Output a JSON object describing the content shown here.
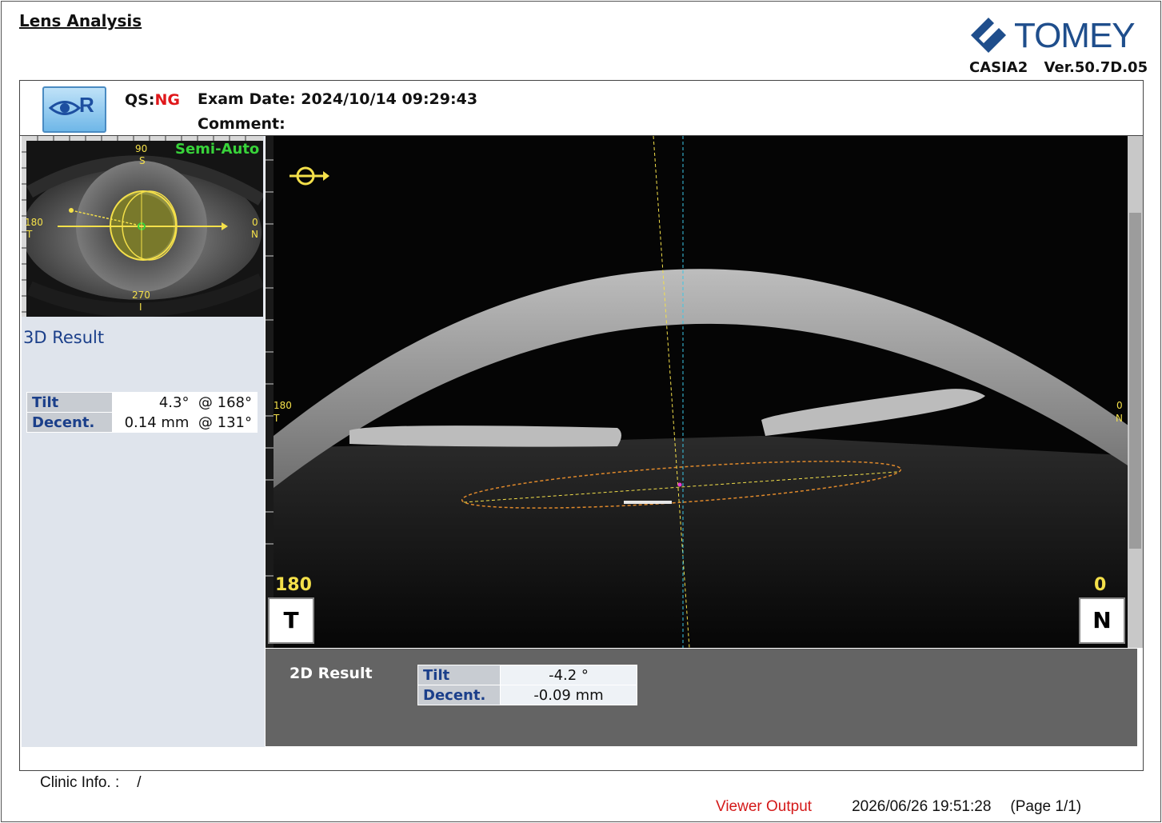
{
  "page": {
    "title": "Lens Analysis",
    "brand": "TOMEY",
    "device": "CASIA2",
    "version": "Ver.50.7D.05"
  },
  "header": {
    "eye": "R",
    "qs_label": "QS:",
    "qs_value": "NG",
    "exam_date_label": "Exam Date:",
    "exam_date": "2024/10/14 09:29:43",
    "comment_label": "Comment:"
  },
  "fundus": {
    "mode": "Semi-Auto",
    "top_deg": "90",
    "top_dir": "S",
    "left_deg": "180",
    "left_dir": "T",
    "right_deg": "0",
    "right_dir": "N",
    "bottom_deg": "270",
    "bottom_dir": "I"
  },
  "result3d": {
    "title": "3D Result",
    "rows": [
      {
        "label": "Tilt",
        "value": "4.3°",
        "angle": "@ 168°"
      },
      {
        "label": "Decent.",
        "value": "0.14 mm",
        "angle": "@ 131°"
      }
    ]
  },
  "oct": {
    "left_angle": "180",
    "left_dir": "T",
    "right_angle": "0",
    "right_dir": "N",
    "scale_left_deg": "180",
    "scale_left_dir": "T",
    "scale_right_deg": "0",
    "scale_right_dir": "N"
  },
  "result2d": {
    "title": "2D Result",
    "rows": [
      {
        "label": "Tilt",
        "value": "-4.2 °"
      },
      {
        "label": "Decent.",
        "value": "-0.09 mm"
      }
    ]
  },
  "footer": {
    "clinic_label": "Clinic Info. :",
    "clinic_value": "/",
    "viewer_output": "Viewer Output",
    "datetime": "2026/06/26 19:51:28",
    "page_info": "(Page 1/1)"
  },
  "colors": {
    "brand_blue": "#1f4e8c",
    "ng_red": "#e0181b",
    "label_blue": "#1b3f8a",
    "overlay_yellow": "#f4e04a",
    "semi_auto_green": "#38d33a"
  }
}
